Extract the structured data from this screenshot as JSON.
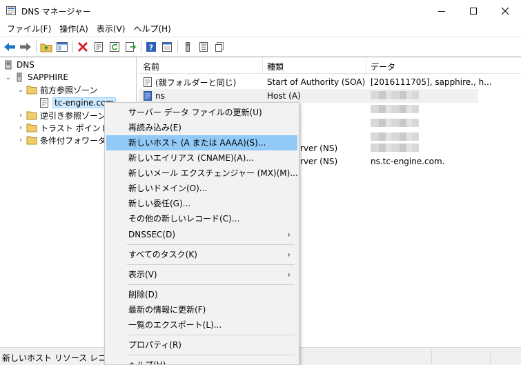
{
  "window": {
    "title": "DNS マネージャー"
  },
  "menubar": [
    "ファイル(F)",
    "操作(A)",
    "表示(V)",
    "ヘルプ(H)"
  ],
  "toolbar": {
    "icons": [
      "back-arrow-icon",
      "forward-arrow-icon",
      "folder-up-icon",
      "show-hide-tree-icon",
      "delete-icon",
      "properties-icon",
      "refresh-icon",
      "export-list-icon",
      "help-icon",
      "console-icon",
      "server-icon",
      "records-icon",
      "copy-icon"
    ],
    "colors": {
      "back": "#1e73c8",
      "delete": "#d42020",
      "refresh": "#2e9b2e",
      "help": "#2c5fb8"
    }
  },
  "tree": {
    "root": "DNS",
    "server": "SAPPHIRE",
    "forward_zones": "前方参照ゾーン",
    "selected_zone": "tc-engine.com",
    "reverse_zones": "逆引き参照ゾーン",
    "trust_points": "トラスト ポイント",
    "conditional_forwarders": "条件付フォワーダー"
  },
  "list": {
    "columns": [
      "名前",
      "種類",
      "データ"
    ],
    "rows": [
      {
        "name": "(親フォルダーと同じ)",
        "type": "Start of Authority (SOA)",
        "data": "[2016111705], sapphire., h..."
      },
      {
        "name": "ns",
        "type": "Host (A)",
        "data": ""
      },
      {
        "name": "",
        "type": "rver (NS)",
        "data": ""
      },
      {
        "name": "",
        "type": "rver (NS)",
        "data": "ns.tc-engine.com."
      }
    ]
  },
  "context_menu": {
    "items": [
      {
        "label": "サーバー データ ファイルの更新(U)"
      },
      {
        "label": "再読み込み(E)"
      },
      {
        "label": "新しいホスト (A または AAAA)(S)..."
      },
      {
        "label": "新しいエイリアス (CNAME)(A)..."
      },
      {
        "label": "新しいメール エクスチェンジャー (MX)(M)..."
      },
      {
        "label": "新しいドメイン(O)..."
      },
      {
        "label": "新しい委任(G)..."
      },
      {
        "label": "その他の新しいレコード(C)..."
      },
      {
        "label": "DNSSEC(D)",
        "arrow": "›"
      },
      {
        "label": "すべてのタスク(K)",
        "arrow": "›"
      },
      {
        "label": "表示(V)",
        "arrow": "›"
      },
      {
        "label": "削除(D)"
      },
      {
        "label": "最新の情報に更新(F)"
      },
      {
        "label": "一覧のエクスポート(L)..."
      },
      {
        "label": "プロパティ(R)"
      },
      {
        "label": "ヘルプ(H)"
      }
    ],
    "active_index": 2,
    "highlight_color": "#91c9f7"
  },
  "statusbar": {
    "text": "新しいホスト リソース レコードを作"
  }
}
